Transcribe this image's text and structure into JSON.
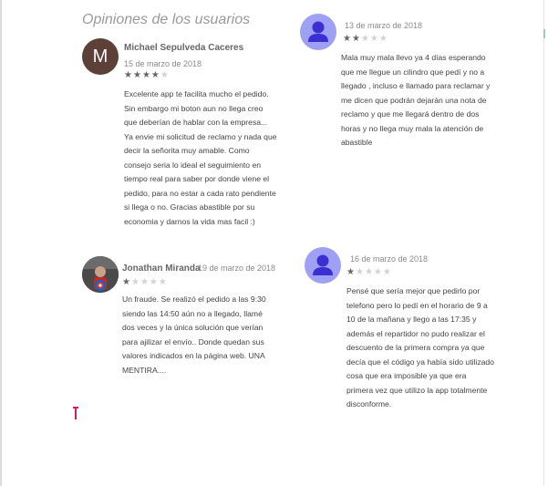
{
  "section": {
    "title": "Opiniones de los usuarios"
  },
  "reviews": [
    {
      "name": "Michael Sepulveda Caceres",
      "avatar_letter": "M",
      "date": "15 de marzo de 2018",
      "rating": 4,
      "text": "Excelente app te facilita mucho el pedido. Sin embargo mi boton aun no llega creo que deberían de hablar con la empresa... Ya envie mi solicitud de reclamo y nada que decir la señorita muy amable. Como consejo seria lo ideal el seguimiento en tiempo real para saber por donde viene el pedido, para no estar a cada rato pendiente si llega o no. Gracias abastible por su economia y darnos la vida mas facil :)"
    },
    {
      "name": "",
      "date": "13 de marzo de 2018",
      "rating": 2,
      "text": "Mala muy mala llevo ya 4 días esperando que me llegue un cilindro que pedí y no a llegado , incluso e llamado para reclamar y me dicen que podrán dejarán una nota de reclamo y que me llegará dentro de dos horas y no llega muy mala la atención de abastible"
    },
    {
      "name": "Jonathan Miranda",
      "date": "19 de marzo de 2018",
      "rating": 1,
      "text": "Un fraude. Se realizó el pedido a las 9:30 siendo las 14:50 aún no a llegado, llamé dos veces y la única solución que verían para ajilizar el envío.. Donde quedan sus valores indicados en la página web. UNA MENTIRA...."
    },
    {
      "name": "",
      "date": "16 de marzo de 2018",
      "rating": 1,
      "text": "Pensé que sería mejor que pedirlo por telefono pero lo pedí en el horario de 9 a 10 de la mañana y llego a las 17:35 y además el repartidor no pudo realizar el descuento de la primera compra ya que decía que el código ya había sido utilizado cosa que era imposible ya que era primera vez que utilizo la app totalmente disconforme."
    }
  ],
  "icons": {
    "person": "person-icon",
    "star": "star-icon",
    "photo": "user-photo-avatar"
  },
  "colors": {
    "letter_avatar": "#5d4037",
    "person_avatar": "#9ea0f5",
    "star_filled": "#666666",
    "star_empty": "#d2d2d2"
  }
}
